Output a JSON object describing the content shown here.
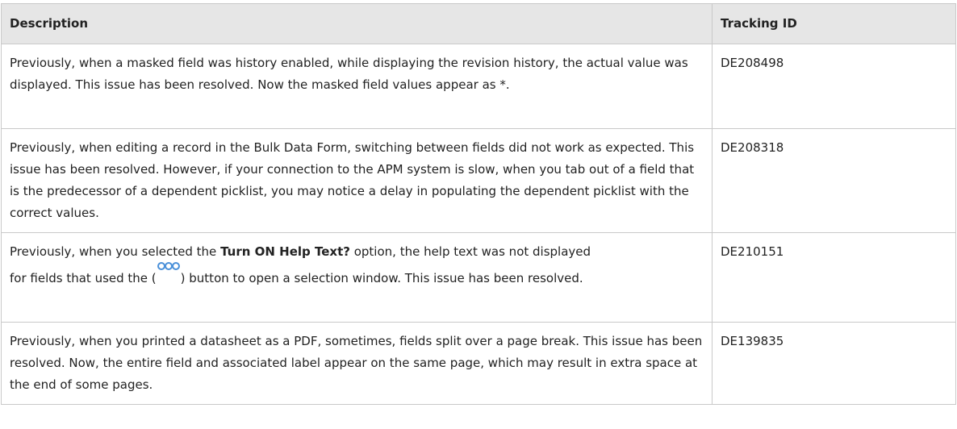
{
  "table": {
    "headers": {
      "description": "Description",
      "tracking_id": "Tracking ID"
    },
    "rows": [
      {
        "description": "Previously, when a masked field was history enabled, while displaying the revision history, the actual value was displayed. This issue has been resolved. Now the masked field values appear as *.",
        "tracking_id": "DE208498"
      },
      {
        "description": "Previously, when editing a record in the Bulk Data Form, switching between fields did not work as expected. This issue has been resolved. However, if your connection to the APM system is slow, when you tab out of a field that is the predecessor of a dependent picklist, you may notice a delay in populating the dependent picklist with the correct values.",
        "tracking_id": "DE208318"
      },
      {
        "description_before_bold": "Previously, when you selected the ",
        "description_bold": "Turn ON Help Text?",
        "description_after_bold": " option, the help text was not displayed",
        "description_line2_before_icon": "for fields that used the (",
        "description_line2_after_icon": ") button to open a selection window. This issue has been resolved.",
        "icon": "ellipsis-button-icon",
        "tracking_id": "DE210151"
      },
      {
        "description": "Previously, when you printed a datasheet as a PDF, sometimes, fields split over a page break. This issue has been resolved. Now, the entire field and associated label appear on the same page, which may result in extra space at the end of some pages.",
        "tracking_id": "DE139835"
      }
    ]
  },
  "colors": {
    "header_bg": "#e6e6e6",
    "border": "#c9c9c9",
    "text": "#222222",
    "icon": "#4a90d9"
  }
}
